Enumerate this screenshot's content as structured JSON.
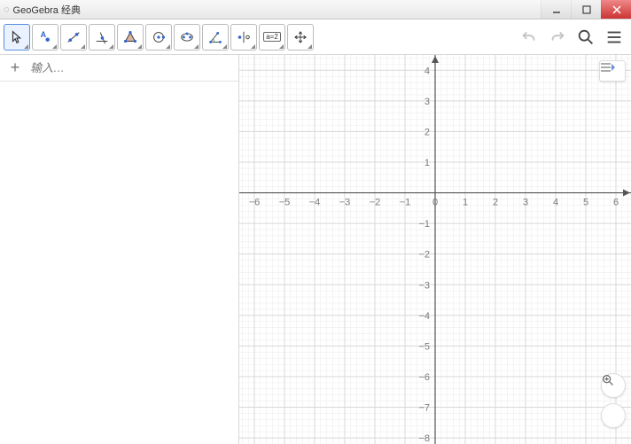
{
  "window": {
    "title": "GeoGebra 经典"
  },
  "toolbar": {
    "tools": [
      {
        "name": "pointer-tool",
        "active": true
      },
      {
        "name": "point-tool"
      },
      {
        "name": "line-tool"
      },
      {
        "name": "perpendicular-tool"
      },
      {
        "name": "polygon-tool"
      },
      {
        "name": "circle-tool"
      },
      {
        "name": "ellipse-tool"
      },
      {
        "name": "angle-tool"
      },
      {
        "name": "reflect-tool"
      },
      {
        "name": "slider-tool",
        "label": "a=2"
      },
      {
        "name": "move-view-tool"
      }
    ]
  },
  "algebra": {
    "input_placeholder": "输入…"
  },
  "chart_data": {
    "type": "scatter",
    "x": [],
    "y": [],
    "x_ticks": [
      -6,
      -5,
      -4,
      -3,
      -2,
      -1,
      0,
      1,
      2,
      3,
      4,
      5,
      6
    ],
    "y_ticks": [
      -8,
      -7,
      -6,
      -5,
      -4,
      -3,
      -2,
      -1,
      1,
      2,
      3,
      4
    ],
    "xlim": [
      -6.5,
      6.5
    ],
    "ylim": [
      -8.2,
      4.5
    ],
    "xlabel": "",
    "ylabel": "",
    "title": "",
    "grid": true,
    "minor_grid_divisions": 5
  }
}
